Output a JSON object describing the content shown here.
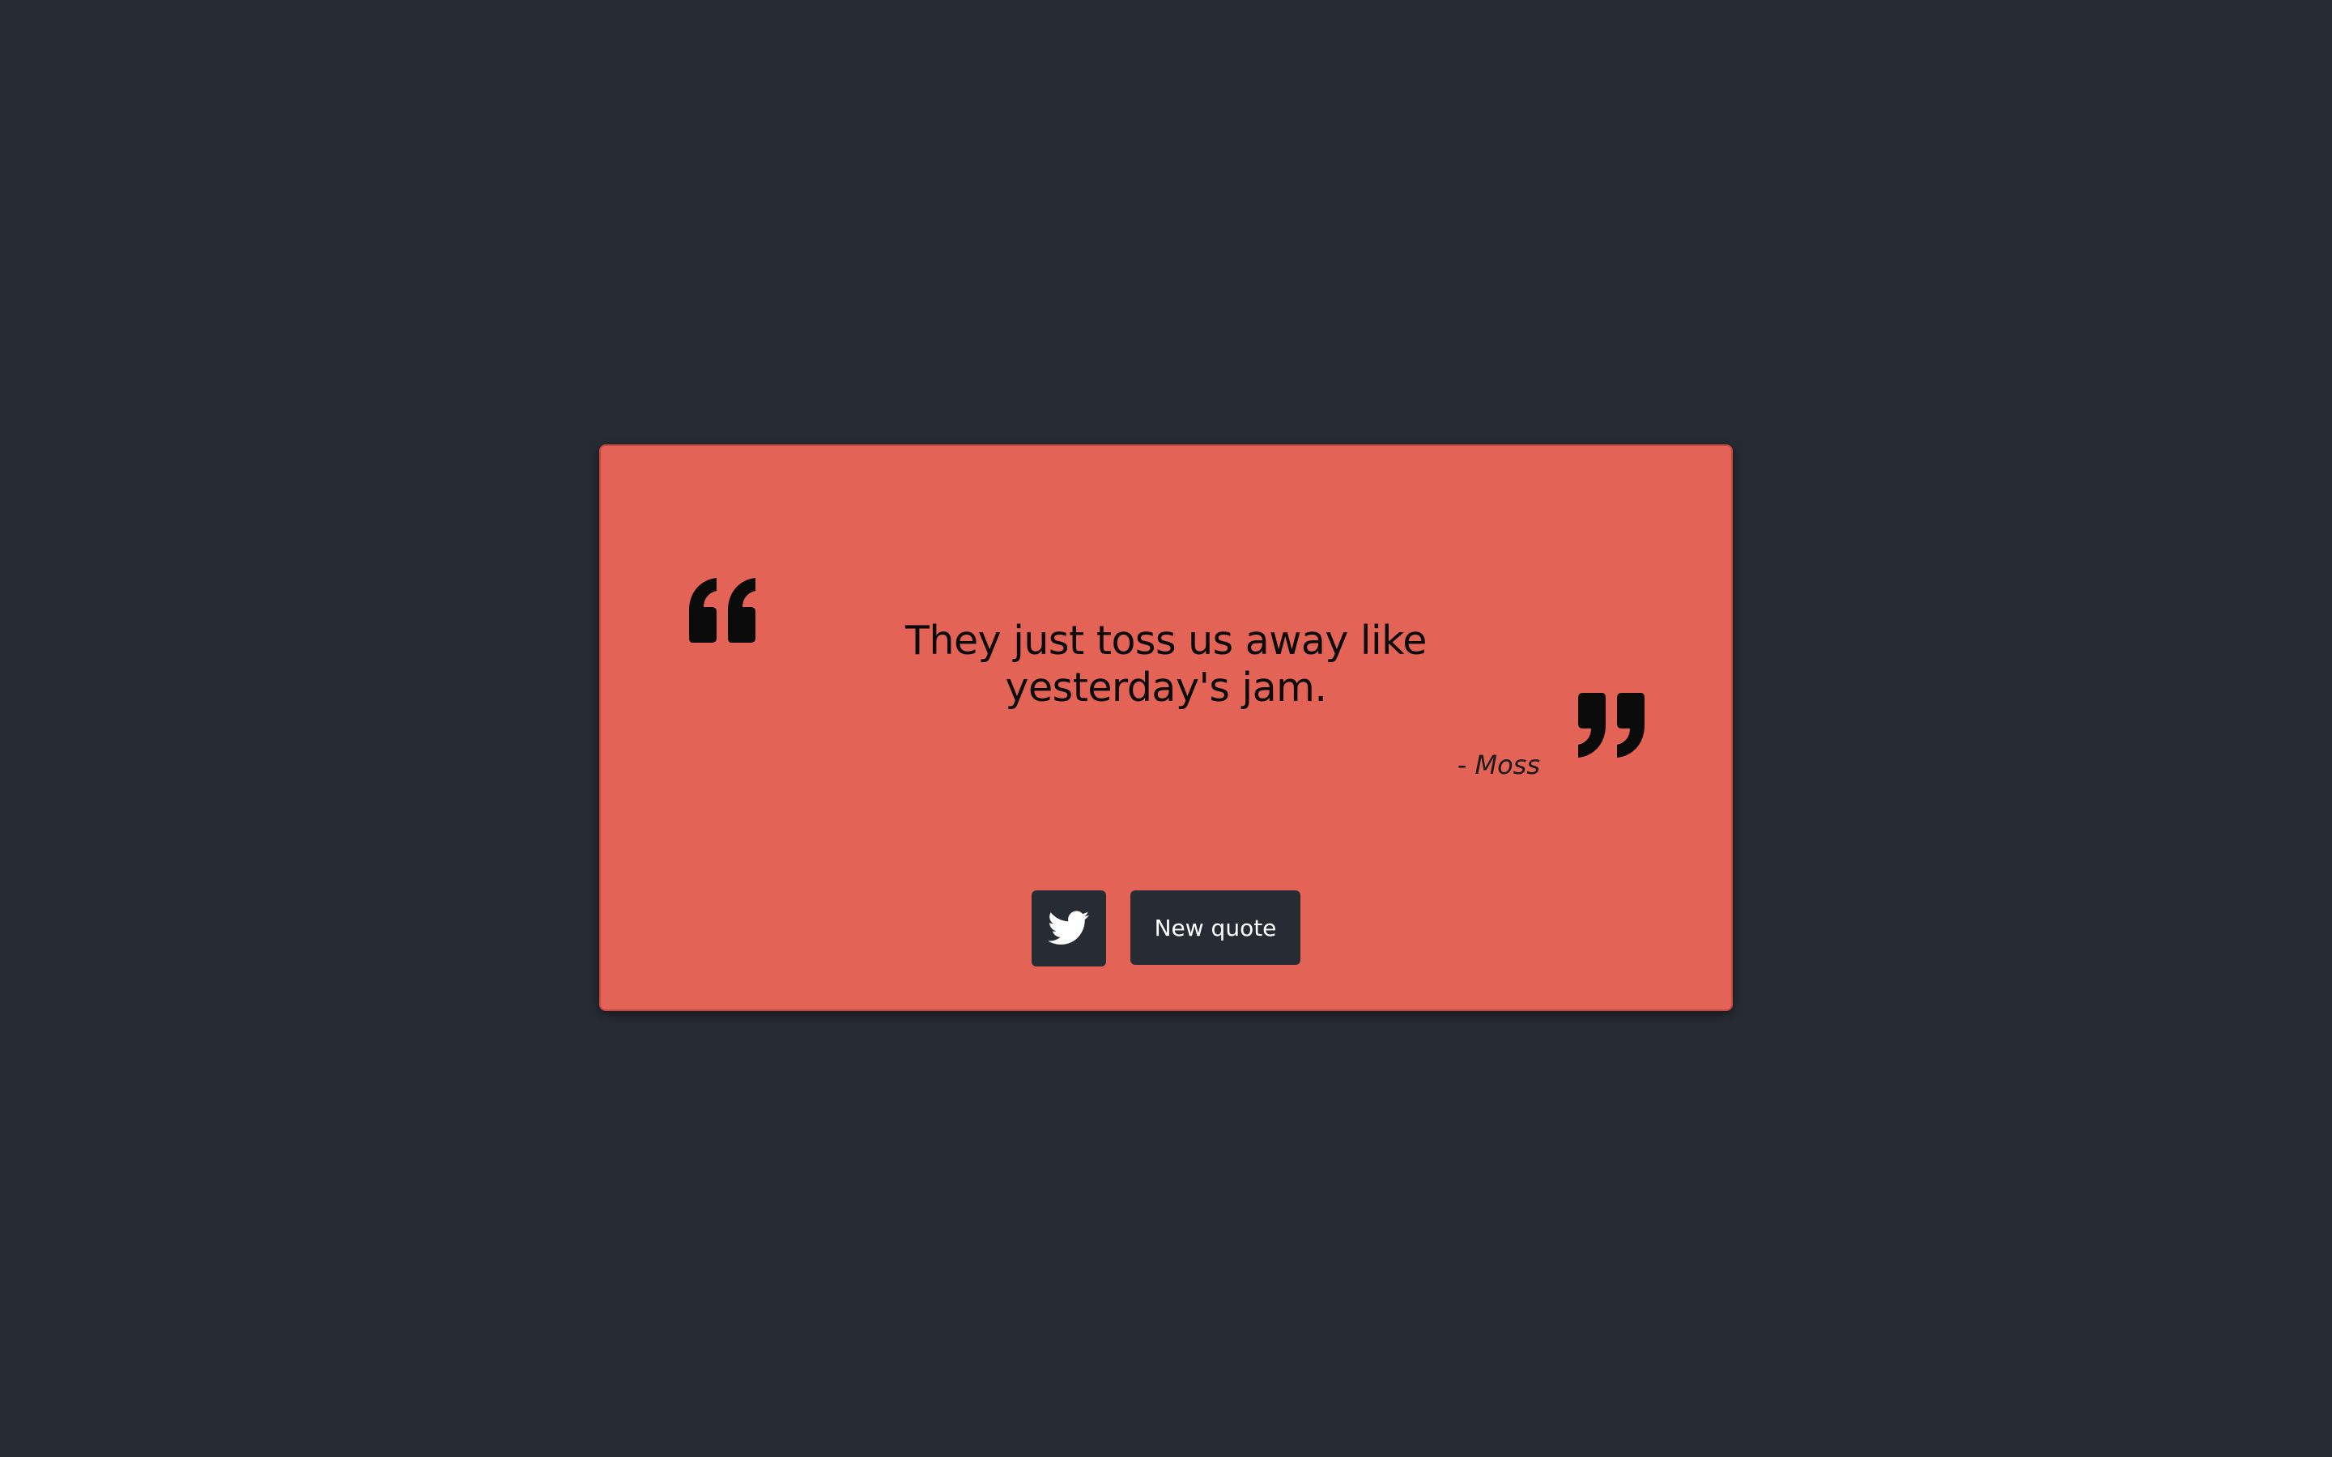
{
  "quote": {
    "text": "They just toss us away like yesterday's jam.",
    "author": "- Moss"
  },
  "actions": {
    "tweet_icon": "twitter-icon",
    "new_quote_label": "New quote"
  },
  "colors": {
    "background": "#272b34",
    "card": "#e46357",
    "button": "#272b34",
    "button_text": "#ffffff",
    "text": "#0b0b0b"
  },
  "icons": {
    "open_quote": "quote-open-icon",
    "close_quote": "quote-close-icon"
  }
}
